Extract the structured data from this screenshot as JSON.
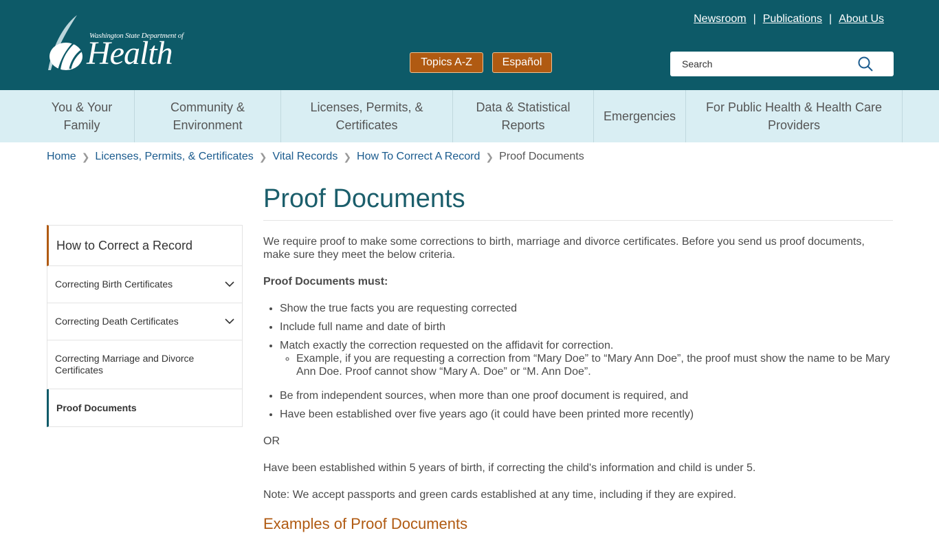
{
  "header": {
    "logo_small": "Washington State Department of",
    "logo_big": "Health",
    "top_links": [
      "Newsroom",
      "Publications",
      "About Us"
    ],
    "link_separator": "|",
    "topics_label": "Topics A-Z",
    "espanol_label": "Español",
    "search_placeholder": "Search",
    "colors": {
      "header_bg": "#0d5a68",
      "accent": "#b05a12",
      "nav_bg": "#d9eef3"
    }
  },
  "nav": {
    "items": [
      "You & Your Family",
      "Community & Environment",
      "Licenses, Permits, & Certificates",
      "Data & Statistical Reports",
      "Emergencies",
      "For Public Health & Health Care Providers"
    ]
  },
  "breadcrumb": {
    "items": [
      "Home",
      "Licenses, Permits, & Certificates",
      "Vital Records",
      "How To Correct A Record"
    ],
    "current": "Proof Documents"
  },
  "sidebar": {
    "heading": "How to Correct a Record",
    "items": [
      {
        "label": "Correcting Birth Certificates",
        "expandable": true
      },
      {
        "label": "Correcting Death Certificates",
        "expandable": true
      },
      {
        "label": "Correcting Marriage and Divorce Certificates",
        "expandable": false
      },
      {
        "label": "Proof Documents",
        "expandable": false,
        "active": true
      }
    ]
  },
  "main": {
    "title": "Proof Documents",
    "intro": "We require proof to make some corrections to birth, marriage and divorce certificates. Before you send us proof documents, make sure they meet the below criteria.",
    "must_heading": "Proof Documents must:",
    "bullets": [
      "Show the true facts you are requesting corrected",
      "Include full name and date of birth",
      "Match exactly the correction requested on the affidavit for correction.",
      "Be from independent sources, when more than one proof document is required, and",
      "Have been established over five years ago (it could have been printed more recently)"
    ],
    "sub_bullet": "Example, if you are requesting a correction from “Mary Doe” to “Mary Ann Doe”, the proof must show the name to be Mary Ann Doe. Proof cannot show “Mary A. Doe” or “M. Ann Doe”.",
    "or_text": "OR",
    "within_text": "Have been established within 5 years of birth, if correcting the child's information and child is under 5.",
    "note_text": "Note: We accept passports and green cards established at any time, including if they are expired.",
    "examples_heading": "Examples of Proof Documents"
  }
}
